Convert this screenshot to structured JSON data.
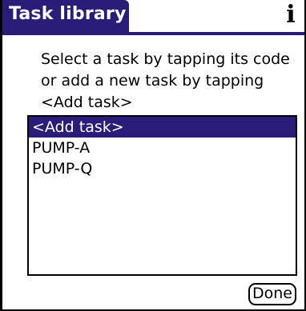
{
  "window": {
    "title": "Task library",
    "info_icon": "i"
  },
  "instructions": [
    "Select a task by tapping its code",
    "or add a new task by tapping",
    "<Add task>"
  ],
  "task_list": {
    "items": [
      {
        "label": "<Add task>",
        "selected": true
      },
      {
        "label": "PUMP-A",
        "selected": false
      },
      {
        "label": "PUMP-Q",
        "selected": false
      }
    ]
  },
  "buttons": {
    "done_label": "Done"
  },
  "colors": {
    "accent": "#2a1d7a",
    "background": "#ffffff",
    "frame": "#000000"
  }
}
